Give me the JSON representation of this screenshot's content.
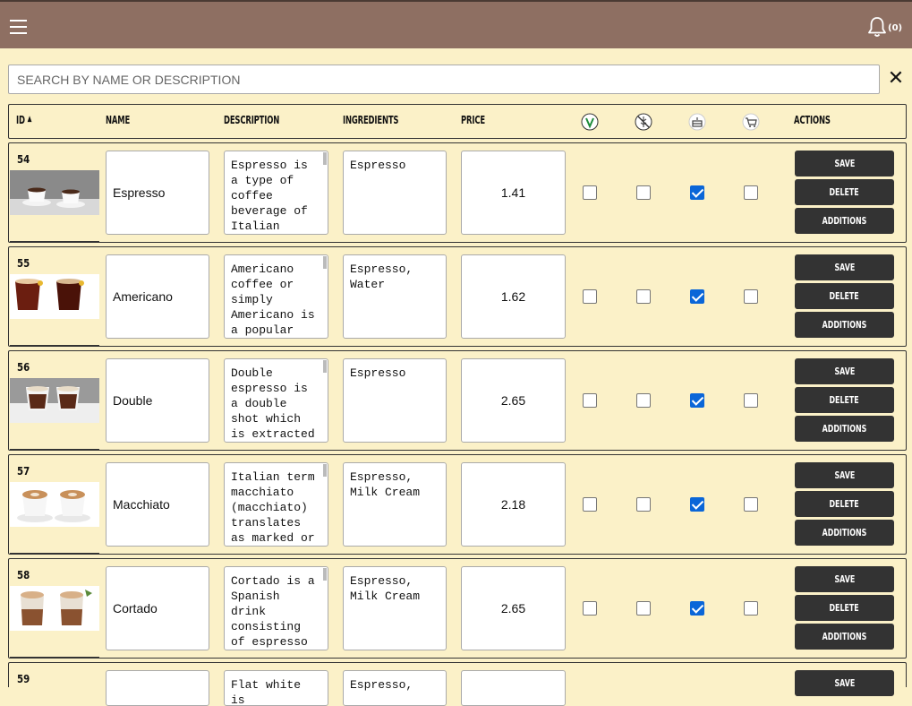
{
  "header": {
    "notification_count": "(0)"
  },
  "search": {
    "placeholder": "SEARCH BY NAME OR DESCRIPTION"
  },
  "table": {
    "columns": {
      "id": "ID",
      "name": "NAME",
      "description": "DESCRIPTION",
      "ingredients": "INGREDIENTS",
      "price": "PRICE",
      "actions": "ACTIONS"
    },
    "sort_indicator": "▲",
    "icon_columns": [
      "vegan-icon",
      "gluten-free-icon",
      "cake-icon",
      "cart-icon"
    ],
    "buttons": {
      "save": "SAVE",
      "delete": "DELETE",
      "additions": "ADDITIONS"
    },
    "rows": [
      {
        "id": "54",
        "name": "Espresso",
        "description": "Espresso is a type of coffee beverage of Italian",
        "ingredients": "Espresso",
        "price": "1.41",
        "flags": [
          false,
          false,
          true,
          false
        ]
      },
      {
        "id": "55",
        "name": "Americano",
        "description": "Americano coffee or simply Americano is a popular",
        "ingredients": "Espresso, Water",
        "price": "1.62",
        "flags": [
          false,
          false,
          true,
          false
        ]
      },
      {
        "id": "56",
        "name": "Double",
        "description": "Double espresso is a double shot which is extracted",
        "ingredients": "Espresso",
        "price": "2.65",
        "flags": [
          false,
          false,
          true,
          false
        ]
      },
      {
        "id": "57",
        "name": "Macchiato",
        "description": "Italian term macchiato (macchiato) translates as marked or",
        "ingredients": "Espresso, Milk Cream",
        "price": "2.18",
        "flags": [
          false,
          false,
          true,
          false
        ]
      },
      {
        "id": "58",
        "name": "Cortado",
        "description": "Cortado is a Spanish drink consisting of espresso mixed with",
        "ingredients": "Espresso, Milk Cream",
        "price": "2.65",
        "flags": [
          false,
          false,
          true,
          false
        ]
      },
      {
        "id": "59",
        "name": "",
        "description": "Flat white is",
        "ingredients": "Espresso,",
        "price": "",
        "flags": [
          false,
          false,
          true,
          false
        ]
      }
    ]
  }
}
